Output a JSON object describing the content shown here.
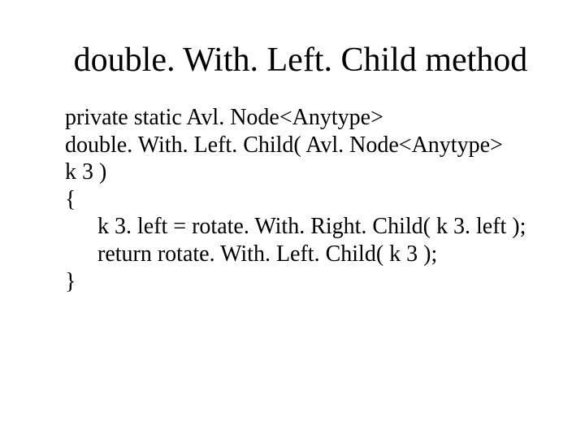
{
  "title": "double. With. Left. Child method",
  "code": {
    "l1": "private static Avl. Node<Anytype>",
    "l2": "double. With. Left. Child( Avl. Node<Anytype>",
    "l3": "k 3 )",
    "l4": "{",
    "l5": "k 3. left = rotate. With. Right. Child( k 3. left );",
    "l6": "return rotate. With. Left. Child( k 3 );",
    "l7": "}"
  }
}
